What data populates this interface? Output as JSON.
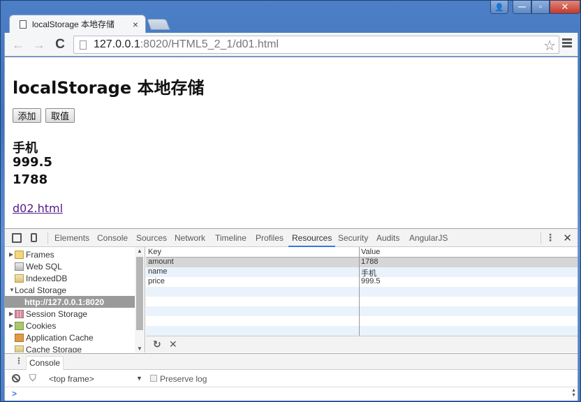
{
  "browser": {
    "tab_title": "localStorage 本地存储",
    "tab_close": "×",
    "url_host": "127.0.0.1",
    "url_rest": ":8020/HTML5_2_1/d01.html",
    "window_buttons": {
      "user": "👤",
      "minimize": "—",
      "maximize": "▫",
      "close": "✕"
    },
    "icons": {
      "back": "←",
      "forward": "→",
      "reload": "C",
      "star": "☆"
    }
  },
  "page": {
    "heading": "localStorage 本地存储",
    "buttons": {
      "add": "添加",
      "get": "取值"
    },
    "outputs": [
      "手机",
      "999.5",
      "1788"
    ],
    "link": "d02.html"
  },
  "devtools": {
    "tabs": [
      "Elements",
      "Console",
      "Sources",
      "Network",
      "Timeline",
      "Profiles",
      "Resources",
      "Security",
      "Audits",
      "AngularJS"
    ],
    "active_tab": "Resources",
    "close": "✕",
    "more": "⋮",
    "sidebar": [
      {
        "label": "Frames",
        "icon": "folder-icon",
        "expander": "▶"
      },
      {
        "label": "Web SQL",
        "icon": "database-icon",
        "expander": ""
      },
      {
        "label": "IndexedDB",
        "icon": "indexeddb-icon",
        "expander": ""
      },
      {
        "label": "Local Storage",
        "icon": "storage-grid-icon",
        "expander": "▼"
      },
      {
        "label": "http://127.0.0.1:8020",
        "icon": "storage-grid-icon",
        "expander": "",
        "selected": true
      },
      {
        "label": "Session Storage",
        "icon": "session-storage-icon",
        "expander": "▶"
      },
      {
        "label": "Cookies",
        "icon": "cookie-icon",
        "expander": "▶"
      },
      {
        "label": "Application Cache",
        "icon": "app-cache-icon",
        "expander": ""
      },
      {
        "label": "Cache Storage",
        "icon": "cache-storage-icon",
        "expander": ""
      }
    ],
    "grid": {
      "headers": {
        "key": "Key",
        "value": "Value"
      },
      "rows": [
        {
          "key": "amount",
          "value": "1788"
        },
        {
          "key": "name",
          "value": "手机"
        },
        {
          "key": "price",
          "value": "999.5"
        }
      ],
      "footer": {
        "refresh": "↻",
        "delete": "✕"
      }
    },
    "drawer": {
      "tab": "Console",
      "context": "<top frame>",
      "dropdown_arrow": "▼",
      "preserve_log": "Preserve log",
      "preserve_log_checked": false,
      "prompt": ">",
      "filter_icon": "⛉"
    },
    "colors": {
      "active_tab_underline": "#3879d9",
      "selected_row": "#9a9a9a",
      "link": "#551a8b"
    }
  }
}
